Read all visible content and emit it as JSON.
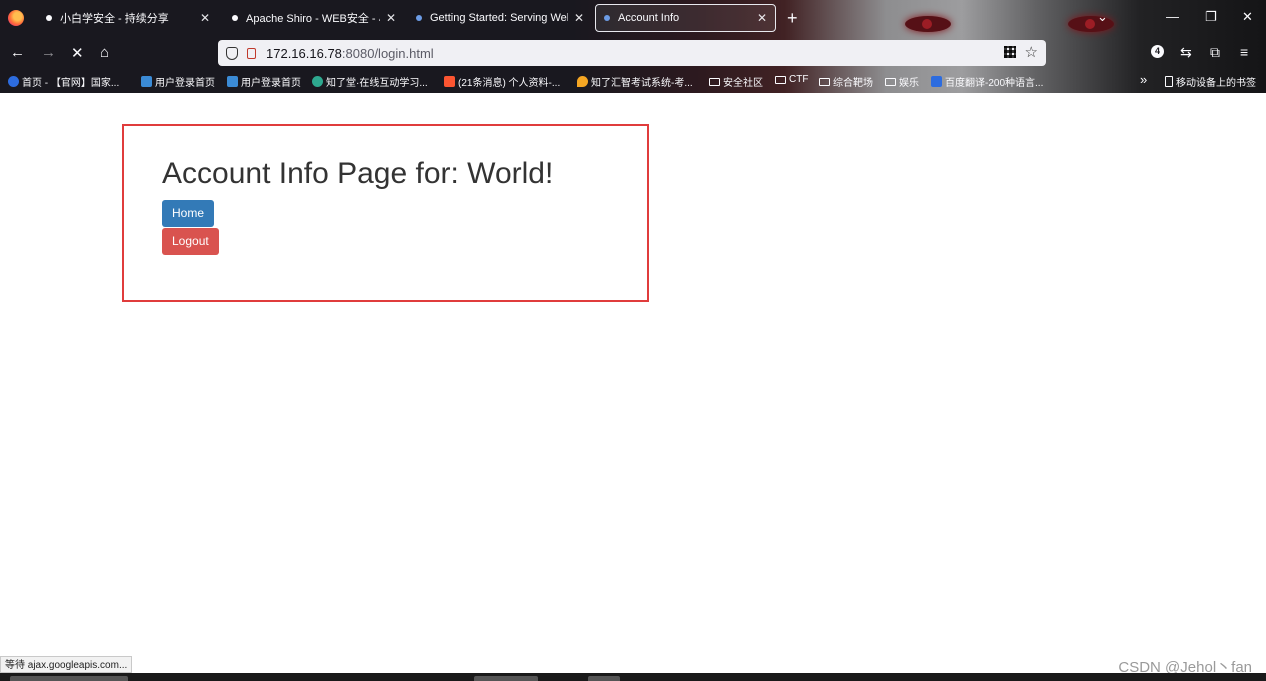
{
  "browser": {
    "tabs": [
      {
        "title": "小白学安全 - 持续分享",
        "active": false
      },
      {
        "title": "Apache Shiro - WEB安全 - 小白",
        "active": false
      },
      {
        "title": "Getting Started: Serving Web",
        "active": false
      },
      {
        "title": "Account Info",
        "active": true
      }
    ],
    "new_tab": "+",
    "url_host": "172.16.16.78",
    "url_rest": ":8080/login.html",
    "extension_badge": "4",
    "bookmarks": [
      "首页 - 【官网】国家...",
      "用户登录首页",
      "用户登录首页",
      "知了堂·在线互动学习...",
      "(21条消息) 个人资料-...",
      "知了汇智考试系统-考...",
      "安全社区",
      "CTF",
      "综合靶场",
      "娱乐",
      "百度翻译-200种语言...",
      "移动设备上的书签"
    ],
    "colors": {
      "frame": "#1c1b22",
      "urlbar": "#f0f0f4"
    }
  },
  "page": {
    "title": "Account Info Page for: World!",
    "home_label": "Home",
    "logout_label": "Logout",
    "colors": {
      "home": "#337ab7",
      "logout": "#d9534f",
      "highlight_box": "#e03c3c"
    }
  },
  "status_text": "等待 ajax.googleapis.com...",
  "watermark": "CSDN @Jehol丶fan"
}
